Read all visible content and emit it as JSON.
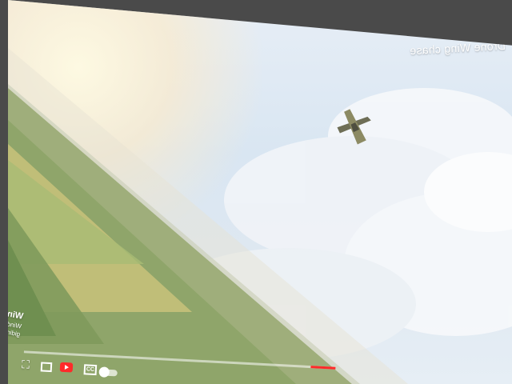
{
  "video": {
    "title": "Drone Wing chase",
    "overlay_heading": "Windows'u Etkinleştir",
    "overlay_line1": "Windows'u etkinleştirmek için Ayarlar'a",
    "overlay_line2": "gidin.",
    "progress_percent": 8
  },
  "controls": {
    "fullscreen_icon": "fullscreen-icon",
    "miniplayer_icon": "miniplayer-icon",
    "youtube_icon": "youtube-logo-icon",
    "cc_label": "CC",
    "autoplay_icon": "autoplay-toggle-icon"
  },
  "colors": {
    "accent": "#ff2a2a",
    "frame": "#555555"
  }
}
